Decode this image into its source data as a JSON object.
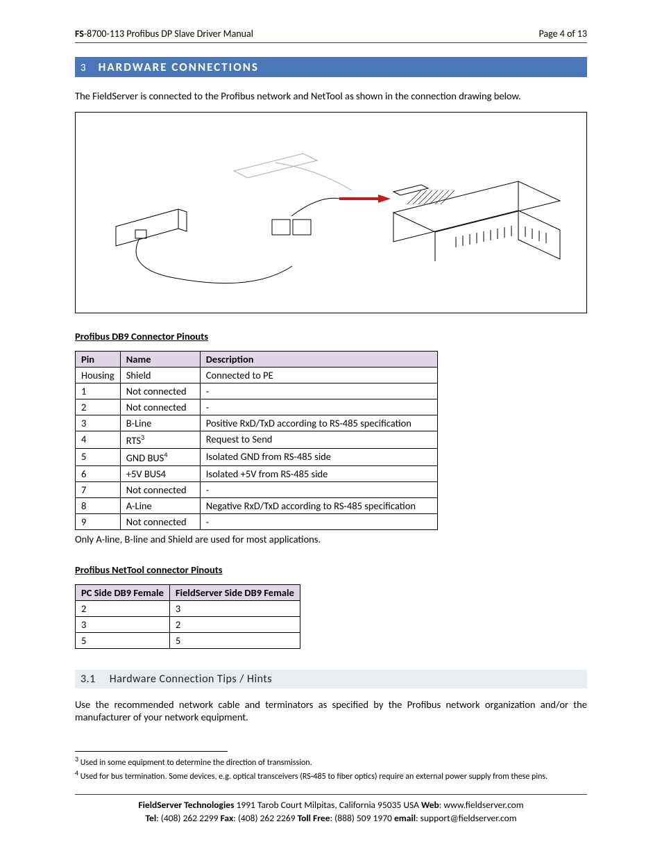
{
  "header": {
    "fs_prefix": "FS",
    "doc_title": "-8700-113 Profibus DP Slave Driver Manual",
    "page_label": "Page 4 of 13"
  },
  "section": {
    "number": "3",
    "title": "HARDWARE CONNECTIONS"
  },
  "intro": "The FieldServer is connected to the Profibus network and NetTool as shown in the connection drawing below.",
  "subheadings": {
    "db9": "Profibus DB9 Connector Pinouts",
    "nettool": "Profibus NetTool connector Pinouts"
  },
  "db9_table": {
    "headers": [
      "Pin",
      "Name",
      "Description"
    ],
    "rows": [
      {
        "pin": "Housing",
        "name": "Shield",
        "name_sup": "",
        "desc": "Connected to PE"
      },
      {
        "pin": "1",
        "name": "Not connected",
        "name_sup": "",
        "desc": "-"
      },
      {
        "pin": "2",
        "name": "Not connected",
        "name_sup": "",
        "desc": "-"
      },
      {
        "pin": "3",
        "name": "B-Line",
        "name_sup": "",
        "desc": "Positive RxD/TxD according to RS-485 specification"
      },
      {
        "pin": "4",
        "name": "RTS",
        "name_sup": "3",
        "desc": "Request to Send"
      },
      {
        "pin": "5",
        "name": "GND BUS",
        "name_sup": "4",
        "desc": "Isolated GND from RS-485 side"
      },
      {
        "pin": "6",
        "name": "+5V BUS4",
        "name_sup": "",
        "desc": "Isolated +5V from RS-485 side"
      },
      {
        "pin": "7",
        "name": "Not connected",
        "name_sup": "",
        "desc": "-"
      },
      {
        "pin": "8",
        "name": "A-Line",
        "name_sup": "",
        "desc": "Negative RxD/TxD according to RS-485 specification"
      },
      {
        "pin": "9",
        "name": "Not connected",
        "name_sup": "",
        "desc": "-"
      }
    ],
    "note": "Only A-line, B-line and Shield are used for most applications."
  },
  "nettool_table": {
    "headers": [
      "PC Side DB9 Female",
      "FieldServer Side DB9 Female"
    ],
    "rows": [
      {
        "l": "2",
        "r": "3"
      },
      {
        "l": "3",
        "r": "2"
      },
      {
        "l": "5",
        "r": "5"
      }
    ]
  },
  "subsection": {
    "number": "3.1",
    "title": "Hardware Connection Tips / Hints"
  },
  "tips_text": "Use the recommended network cable and terminators as specified by the Profibus network organization and/or the manufacturer of your network equipment.",
  "footnotes": {
    "f3": "Used in some equipment to determine the direction of transmission.",
    "f4": "Used for bus termination.  Some devices, e.g. optical transceivers (RS-485 to fiber optics) require an external power supply from these pins."
  },
  "footer": {
    "company": "FieldServer Technologies",
    "address": " 1991 Tarob Court Milpitas, California 95035 USA   ",
    "web_label": "Web",
    "web": ": www.fieldserver.com",
    "tel_label": "Tel",
    "tel": ": (408) 262 2299  ",
    "fax_label": "Fax",
    "fax": ": (408) 262 2269  ",
    "tollfree_label": "Toll Free",
    "tollfree": ": (888) 509 1970  ",
    "email_label": "email",
    "email": ": support@fieldserver.com"
  }
}
